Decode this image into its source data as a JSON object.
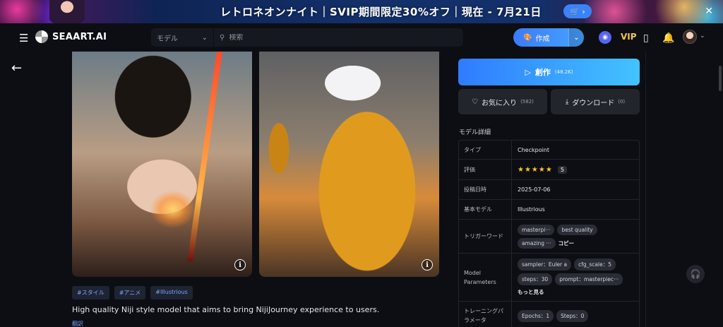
{
  "banner": {
    "text": "レトロネオンナイト｜SVIP期間限定30%オフ｜現在 - 7月21日",
    "cart_label": "🛒 ›",
    "close_label": "✕"
  },
  "header": {
    "logo_text": "SEAART.AI",
    "model_select": "モデル",
    "search_placeholder": "検索",
    "create_label": "作成",
    "vip_label": "VIP"
  },
  "tags": [
    "#スタイル",
    "#アニメ",
    "#Illustrious"
  ],
  "description": "High quality Niji style model that aims to bring NijiJourney experience to users.",
  "translate_label": "翻訳",
  "actions": {
    "create_label": "創作",
    "create_count": "(48.2K)",
    "favorite_label": "お気に入り",
    "favorite_count": "(582)",
    "download_label": "ダウンロード",
    "download_count": "(0)"
  },
  "details": {
    "title": "モデル詳細",
    "type_key": "タイプ",
    "type_val": "Checkpoint",
    "rating_key": "評価",
    "rating_stars": "★★★★★",
    "rating_val": "5",
    "date_key": "投稿日時",
    "date_val": "2025-07-06",
    "base_key": "基本モデル",
    "base_val": "Illustrious",
    "trigger_key": "トリガーワード",
    "trigger_words": [
      "masterpi···",
      "best quality",
      "amazing ···"
    ],
    "copy_label": "コピー",
    "params_key": "Model Parameters",
    "params": [
      "sampler：Euler a",
      "cfg_scale：5",
      "steps：30",
      "prompt：masterpiec···"
    ],
    "more_label": "もっと見る",
    "training_key": "トレーニングパラメータ",
    "training": [
      "Epochs：1",
      "Steps：0"
    ]
  }
}
